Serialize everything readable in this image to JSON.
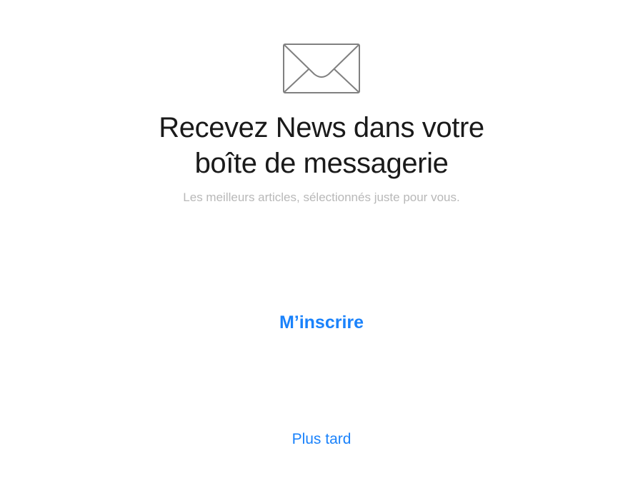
{
  "icon": "envelope-icon",
  "colors": {
    "accent": "#1a82fb",
    "headline": "#1a1a1a",
    "subtitle": "#b8b8b8",
    "icon_stroke": "#808080",
    "background": "#ffffff"
  },
  "headline": {
    "line1": "Recevez News dans votre",
    "line2": "boîte de messagerie"
  },
  "subtitle": "Les meilleurs articles, sélectionnés juste pour vous.",
  "actions": {
    "subscribe_label": "M’inscrire",
    "later_label": "Plus tard"
  }
}
